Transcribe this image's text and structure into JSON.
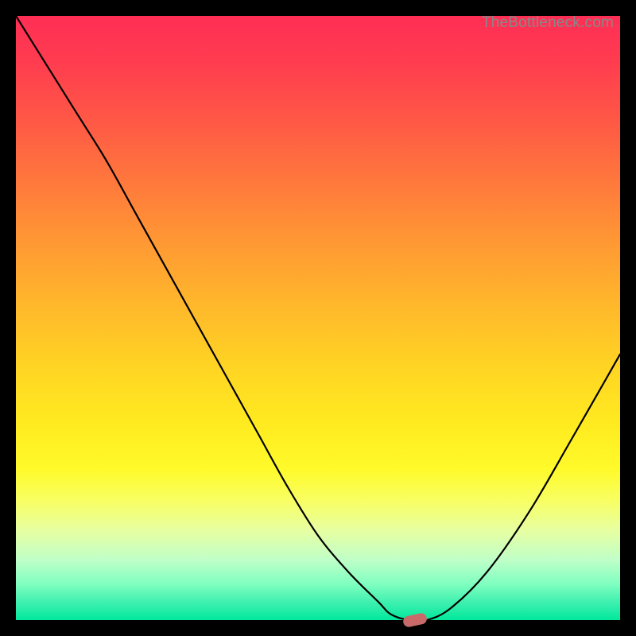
{
  "watermark": "TheBottleneck.com",
  "chart_data": {
    "type": "line",
    "x": [
      0,
      5,
      10,
      15,
      20,
      25,
      30,
      35,
      40,
      45,
      50,
      55,
      60,
      62,
      65,
      68,
      72,
      78,
      85,
      92,
      100
    ],
    "values": [
      100,
      92,
      84,
      76,
      67,
      58,
      49,
      40,
      31,
      22,
      14,
      8,
      3,
      1,
      0,
      0,
      2,
      8,
      18,
      30,
      44
    ],
    "title": "",
    "xlabel": "",
    "ylabel": "",
    "xlim": [
      0,
      100
    ],
    "ylim": [
      0,
      100
    ],
    "marker": {
      "x": 66,
      "y": 0
    },
    "background_gradient": [
      "#FF2E55",
      "#FFD423",
      "#FFFA2A",
      "#00E89C"
    ]
  }
}
